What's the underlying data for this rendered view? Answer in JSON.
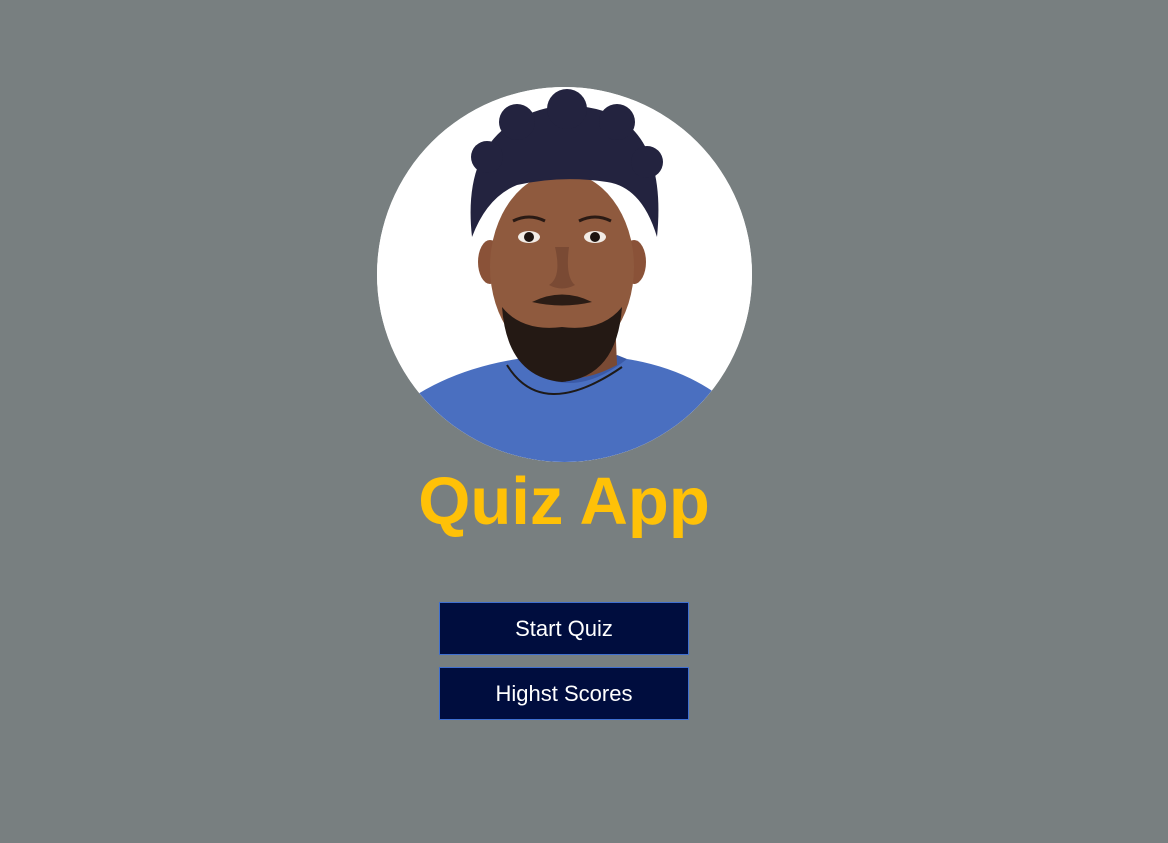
{
  "app": {
    "title": "Quiz App",
    "title_color": "#ffc107",
    "background_color": "#787f80"
  },
  "profile": {
    "avatar_icon": "profile-photo"
  },
  "menu": {
    "start_label": "Start Quiz",
    "scores_label": "Highst Scores",
    "button_color": "#000d3e"
  }
}
